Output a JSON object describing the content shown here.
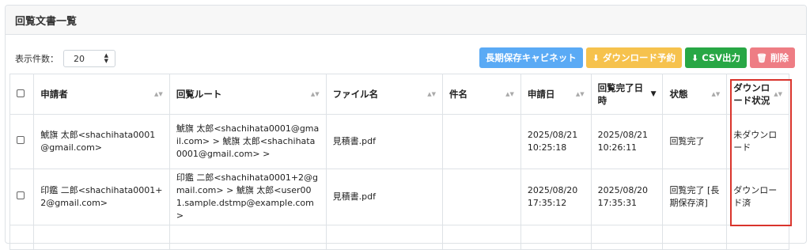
{
  "header": {
    "title": "回覧文書一覧"
  },
  "toolbar": {
    "per_page_label": "表示件数：",
    "per_page_value": "20",
    "buttons": {
      "cabinet": "長期保存キャビネット",
      "download_reserve": "ダウンロード予約",
      "csv": "CSV出力",
      "delete": "削除"
    }
  },
  "table": {
    "columns": {
      "applicant": "申請者",
      "route": "回覧ルート",
      "file": "ファイル名",
      "subject": "件名",
      "applied": "申請日",
      "completed": "回覧完了日時",
      "status": "状態",
      "download": "ダウンロード状況"
    },
    "rows": [
      {
        "applicant": "鯱旗 太郎<shachihata0001@gmail.com>",
        "route": "鯱旗 太郎<shachihata0001@gmail.com> > 鯱旗 太郎<shachihata0001@gmail.com> >",
        "file": "見積書.pdf",
        "subject": "",
        "applied": "2025/08/21 10:25:18",
        "completed": "2025/08/21 10:26:11",
        "status": "回覧完了",
        "download": "未ダウンロード"
      },
      {
        "applicant": "印鑑 二郎<shachihata0001+2@gmail.com>",
        "route": "印鑑 二郎<shachihata0001+2@gmail.com> > 鯱旗 太郎<user001.sample.dstmp@example.com>",
        "file": "見積書.pdf",
        "subject": "",
        "applied": "2025/08/20 17:35:12",
        "completed": "2025/08/20 17:35:31",
        "status": "回覧完了 [長期保存済]",
        "download": "ダウンロード済"
      }
    ]
  },
  "colors": {
    "highlight": "#d9342c",
    "cabinet": "#5aaaf5",
    "download": "#f6c24d",
    "csv": "#28a745",
    "delete": "#ee7d84"
  }
}
